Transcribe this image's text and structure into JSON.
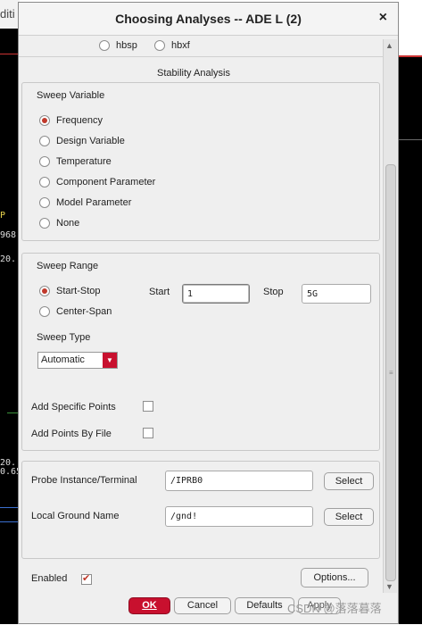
{
  "background": {
    "left_labels": [
      "diti",
      "P",
      "968",
      "20.",
      "20.",
      "0.65"
    ]
  },
  "dialog": {
    "title": "Choosing Analyses -- ADE L (2)",
    "close_glyph": "×",
    "top_radios": [
      {
        "label": "hbsp",
        "selected": false
      },
      {
        "label": "hbxf",
        "selected": false
      }
    ],
    "section_title": "Stability Analysis",
    "sweep_variable": {
      "title": "Sweep Variable",
      "options": [
        {
          "label": "Frequency",
          "selected": true
        },
        {
          "label": "Design Variable",
          "selected": false
        },
        {
          "label": "Temperature",
          "selected": false
        },
        {
          "label": "Component Parameter",
          "selected": false
        },
        {
          "label": "Model Parameter",
          "selected": false
        },
        {
          "label": "None",
          "selected": false
        }
      ]
    },
    "sweep_range": {
      "title": "Sweep Range",
      "options": [
        {
          "label": "Start-Stop",
          "selected": true
        },
        {
          "label": "Center-Span",
          "selected": false
        }
      ],
      "start_label": "Start",
      "start_value": "1",
      "stop_label": "Stop",
      "stop_value": "5G",
      "sweep_type_label": "Sweep Type",
      "sweep_type_value": "Automatic",
      "add_specific_points": "Add Specific Points",
      "add_points_by_file": "Add Points By File"
    },
    "probe": {
      "instance_label": "Probe Instance/Terminal",
      "instance_value": "/IPRB0",
      "ground_label": "Local Ground Name",
      "ground_value": "/gnd!",
      "select_label": "Select"
    },
    "enabled_label": "Enabled",
    "enabled_checked": true,
    "options_button": "Options...",
    "buttons": {
      "ok": "OK",
      "cancel": "Cancel",
      "defaults": "Defaults",
      "apply": "Apply"
    }
  },
  "watermark": "CSDN @落落暮落",
  "colors": {
    "accent": "#c8102e",
    "radio_dot": "#c0392b"
  }
}
